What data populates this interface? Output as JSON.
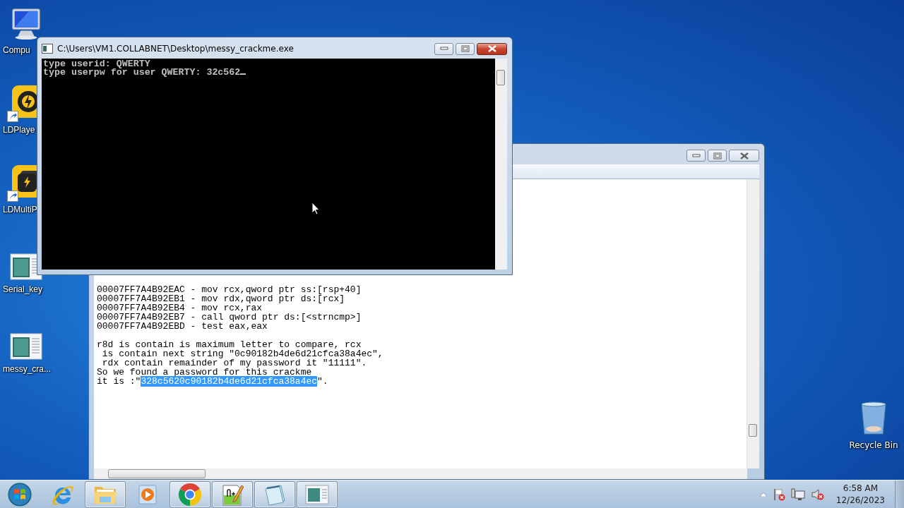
{
  "desktop_icons": [
    {
      "label": "Compu",
      "kind": "computer",
      "shortcut": false
    },
    {
      "label": "LDPlaye",
      "kind": "ldplayer",
      "shortcut": true
    },
    {
      "label": "LDMultiP",
      "kind": "ldmulti",
      "shortcut": true
    },
    {
      "label": "Serial_key",
      "kind": "app",
      "shortcut": false
    },
    {
      "label": "messy_cra...",
      "kind": "app",
      "shortcut": false
    }
  ],
  "recycle_bin": {
    "label": "Recycle Bin"
  },
  "notepad": {
    "blocks": [
      {
        "lines": [
          {
            "segments": [
              {
                "text": "00007FF7A4B92EAC - mov rcx,qword ptr ss:[rsp+40]",
                "selected": false
              }
            ]
          },
          {
            "segments": [
              {
                "text": "00007FF7A4B92EB1 - mov rdx,qword ptr ds:[rcx]",
                "selected": false
              }
            ]
          },
          {
            "segments": [
              {
                "text": "00007FF7A4B92EB4 - mov rcx,rax",
                "selected": false
              }
            ]
          },
          {
            "segments": [
              {
                "text": "00007FF7A4B92EB7 - call qword ptr ds:[<strncmp>]",
                "selected": false
              }
            ]
          },
          {
            "segments": [
              {
                "text": "00007FF7A4B92EBD - test eax,eax",
                "selected": false
              }
            ]
          }
        ]
      },
      {
        "lines": [
          {
            "segments": [
              {
                "text": "r8d is contain is maximum letter to compare, rcx",
                "selected": false
              }
            ]
          },
          {
            "segments": [
              {
                "text": " is contain next string \"0c90182b4de6d21cfca38a4ec\",",
                "selected": false
              }
            ]
          },
          {
            "segments": [
              {
                "text": " rdx contain remainder of my password it \"11111\".",
                "selected": false
              }
            ]
          },
          {
            "segments": [
              {
                "text": "So we found a password for this crackme",
                "selected": false
              }
            ]
          },
          {
            "segments": [
              {
                "text": "it is :\"",
                "selected": false
              },
              {
                "text": "328c5620c90182b4de6d21cfca38a4ec",
                "selected": true
              },
              {
                "text": "\".",
                "selected": false
              }
            ]
          }
        ]
      }
    ]
  },
  "console": {
    "title": "C:\\Users\\VM1.COLLABNET\\Desktop\\messy_crackme.exe",
    "lines": [
      "type userid: QWERTY",
      "type userpw for user QWERTY: 32c562"
    ]
  },
  "taskbar": {
    "buttons": [
      {
        "kind": "ie",
        "running": false
      },
      {
        "kind": "folder",
        "running": true
      },
      {
        "kind": "media",
        "running": false
      },
      {
        "kind": "chrome",
        "running": true
      },
      {
        "kind": "notepadpp",
        "running": true
      },
      {
        "kind": "notepad",
        "running": true
      },
      {
        "kind": "app",
        "running": true
      }
    ],
    "tray": {
      "time": "6:58 AM",
      "date": "12/26/2023"
    }
  }
}
